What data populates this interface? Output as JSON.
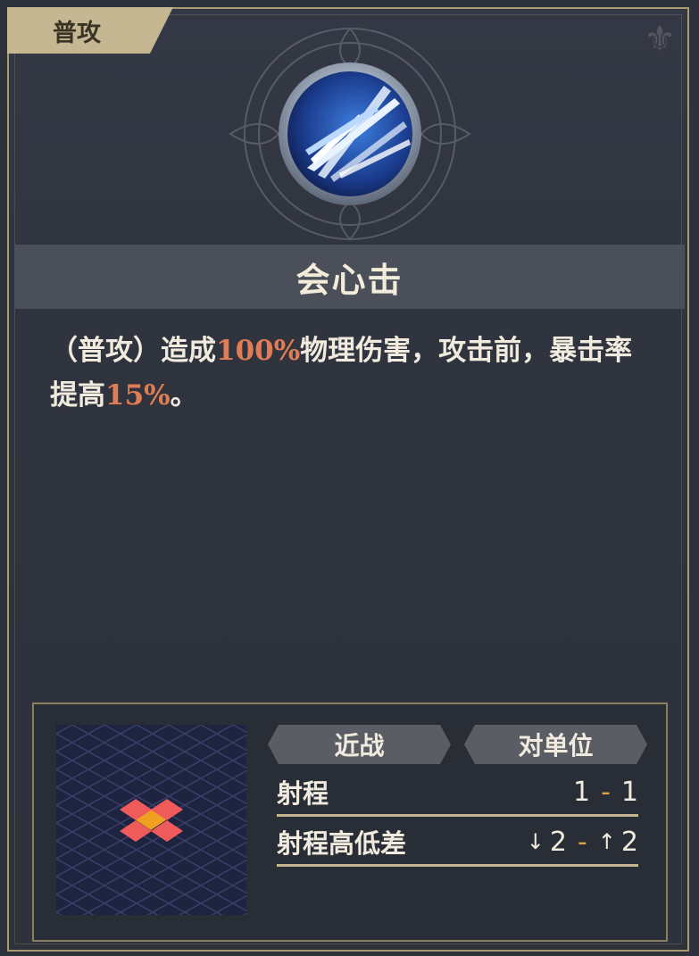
{
  "skill": {
    "type_tag": "普攻",
    "name": "会心击",
    "description_parts": [
      {
        "text": "（普攻）造成",
        "highlight": false
      },
      {
        "text": "100%",
        "highlight": true
      },
      {
        "text": "物理伤害，攻击前，暴击率提高",
        "highlight": false
      },
      {
        "text": "15%",
        "highlight": true
      },
      {
        "text": "。",
        "highlight": false
      }
    ],
    "icon": "ice-slash-icon"
  },
  "info": {
    "attack_type": "近战",
    "target": "对单位",
    "range": {
      "label": "射程",
      "min": "1",
      "sep": "-",
      "max": "1"
    },
    "height_diff": {
      "label": "射程高低差",
      "down_arrow": "↓",
      "down": "2",
      "sep": "-",
      "up_arrow": "↑",
      "up": "2"
    }
  },
  "colors": {
    "highlight": "#e07d55",
    "frame_gold": "#a99a72",
    "range_cell": "#ef5a5a",
    "center_cell": "#f0a020",
    "separator": "#d9a441"
  }
}
